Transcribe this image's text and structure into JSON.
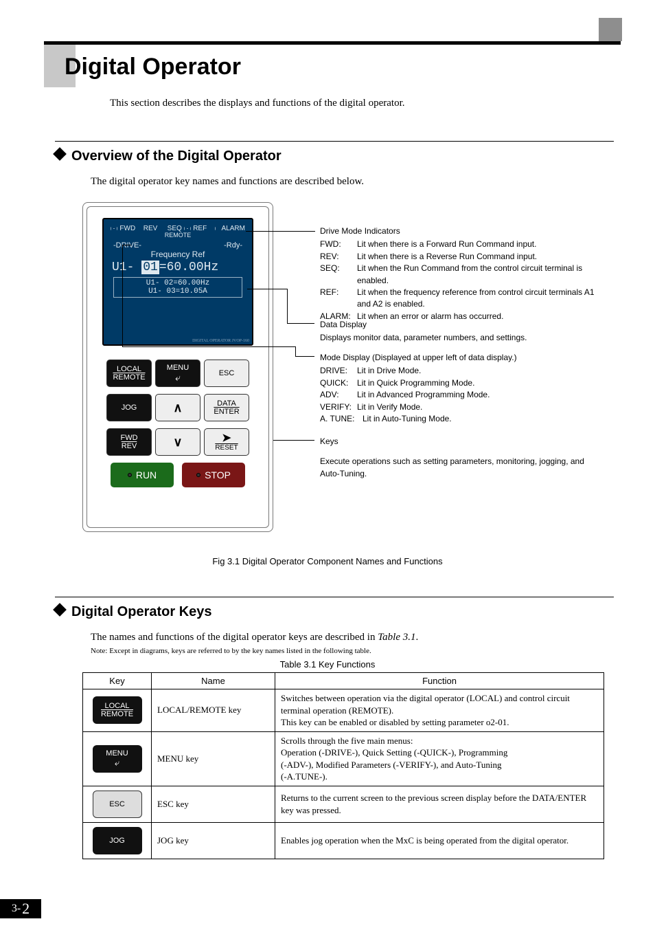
{
  "page": {
    "title": "Digital Operator",
    "intro": "This section describes the displays and functions of the digital operator.",
    "number_prefix": "3",
    "number_dash": "-",
    "number_main": "2"
  },
  "sec1": {
    "heading": "Overview of the Digital Operator",
    "body": "The digital operator key names and functions are described below."
  },
  "sec2": {
    "heading": "Digital Operator Keys",
    "body": "The names and functions of the digital operator keys are described in Table 3.1.",
    "note": "Note: Except in diagrams, keys are referred to by the key names listed in the following table."
  },
  "fig": {
    "caption": "Fig 3.1  Digital Operator Component Names and Functions"
  },
  "tablecap": "Table 3.1  Key Functions",
  "lcd": {
    "inds": {
      "fwd": "FWD",
      "rev": "REV",
      "seq": "SEQ",
      "ref": "REF",
      "remote": "REMOTE",
      "alarm": "ALARM"
    },
    "line_drive": "-DRIVE-",
    "line_rdy": "-Rdy-",
    "line_freqref": "Frequency Ref",
    "big_pre": "U1-",
    "big_hl": "01",
    "big_post": "=60.00Hz",
    "sub1": "U1- 02=60.00Hz",
    "sub2": "U1- 03=10.05A",
    "model": "DIGITAL OPERATOR JVOP-160"
  },
  "keys": {
    "local": "LOCAL",
    "remote": "REMOTE",
    "menu": "MENU",
    "esc": "ESC",
    "jog": "JOG",
    "data": "DATA",
    "enter": "ENTER",
    "fwd": "FWD",
    "rev": "REV",
    "reset": "RESET",
    "run": "RUN",
    "stop": "STOP"
  },
  "ann": {
    "dmi": {
      "title": "Drive Mode Indicators",
      "fwd_l": "FWD:",
      "fwd_t": "Lit when there is a Forward Run Command input.",
      "rev_l": "REV:",
      "rev_t": "Lit when there is a Reverse Run Command input.",
      "seq_l": "SEQ:",
      "seq_t": "Lit when the Run Command from the control circuit terminal is enabled.",
      "ref_l": "REF:",
      "ref_t": "Lit when the frequency reference from control circuit terminals A1 and A2 is enabled.",
      "alm_l": "ALARM:",
      "alm_t": "Lit when an error or alarm has occurred."
    },
    "dd": {
      "title": "Data Display",
      "t": "Displays monitor data, parameter numbers, and settings."
    },
    "md": {
      "title": "Mode Display (Displayed at upper left of data display.)",
      "drive_l": "DRIVE:",
      "drive_t": "Lit in Drive Mode.",
      "quick_l": "QUICK:",
      "quick_t": "Lit in Quick Programming Mode.",
      "adv_l": "ADV:",
      "adv_t": "Lit in Advanced Programming Mode.",
      "ver_l": "VERIFY:",
      "ver_t": "Lit in Verify Mode.",
      "at_l": "A. TUNE:",
      "at_t": "Lit in Auto-Tuning Mode."
    },
    "k": {
      "title": "Keys",
      "t": "Execute operations such as setting parameters, monitoring, jogging, and Auto-Tuning."
    }
  },
  "table": {
    "h1": "Key",
    "h2": "Name",
    "h3": "Function",
    "r1": {
      "name": "LOCAL/REMOTE key",
      "func": "Switches between operation via the digital operator (LOCAL) and control circuit terminal operation (REMOTE).\nThis key can be enabled or disabled by setting parameter o2-01."
    },
    "r2": {
      "name": "MENU key",
      "func": "Scrolls through the five main menus:\nOperation (-DRIVE-), Quick Setting (-QUICK-), Programming\n(-ADV-), Modified Parameters (-VERIFY-), and Auto-Tuning\n(-A.TUNE-)."
    },
    "r3": {
      "name": "ESC key",
      "func": "Returns to the current screen to the previous screen display before the DATA/ENTER key was pressed."
    },
    "r4": {
      "name": "JOG key",
      "func": "Enables jog operation when the MxC is being operated from the digital operator."
    }
  }
}
